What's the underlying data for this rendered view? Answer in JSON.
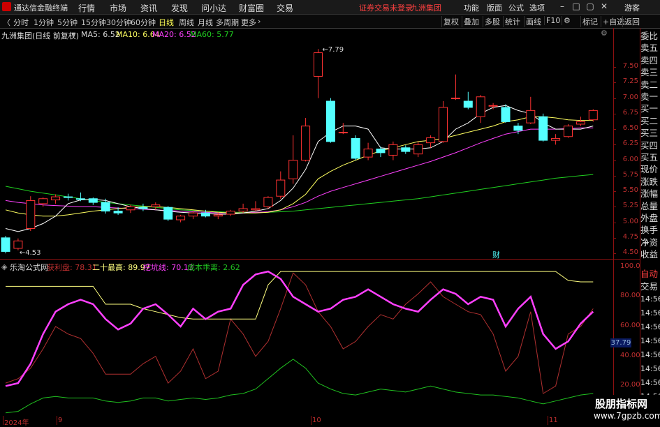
{
  "app": {
    "title": "通达信金融终端",
    "menus": [
      "行情",
      "市场",
      "资讯",
      "发现",
      "问小达",
      "财富圈",
      "交易"
    ],
    "notice": "证券交易未登录",
    "broker": "九洲集团",
    "right_menus": [
      "功能",
      "版面",
      "公式",
      "选项"
    ],
    "guest": "游客"
  },
  "toolbar": {
    "periods": [
      "分时",
      "1分钟",
      "5分钟",
      "15分钟",
      "30分钟",
      "60分钟",
      "日线",
      "周线",
      "月线",
      "多周期",
      "更多"
    ],
    "active": "日线",
    "right_buttons": [
      "复权",
      "叠加",
      "多股",
      "统计",
      "画线",
      "F10",
      "标记",
      "+自选",
      "返回"
    ]
  },
  "main_info": {
    "stock": "九洲集团(日线 前复权)",
    "ma5": "MA5: 6.52",
    "ma10": "MA10: 6.64",
    "ma20": "MA20: 6.52",
    "ma60": "MA60: 5.77",
    "high_label": "7.79",
    "low_label": "4.53",
    "event_marker": "财"
  },
  "sub_info": {
    "formula": "乐淘公式网",
    "l1": "获利盘: 78.31",
    "l2": "二十最高: 89.97",
    "l3": "挖坑线: 70.13",
    "l4": "成本乖离: 2.62"
  },
  "right_panel": {
    "items": [
      "委比",
      "卖五",
      "卖四",
      "卖三",
      "卖二",
      "卖一",
      "买一",
      "买二",
      "买三",
      "买四",
      "买五",
      "现价",
      "涨跌",
      "涨幅",
      "总量",
      "外盘",
      "换手",
      "净资",
      "收益"
    ],
    "lower_items": [
      "自动",
      "交易"
    ],
    "times": [
      "14:56",
      "14:56",
      "14:56",
      "14:56",
      "14:56",
      "14:56",
      "14:56",
      "14:56"
    ]
  },
  "axes": {
    "main_ticks": [
      "7.50",
      "7.25",
      "7.00",
      "6.75",
      "6.50",
      "6.25",
      "6.00",
      "5.75",
      "5.50",
      "5.25",
      "5.00",
      "4.75",
      "4.50"
    ],
    "sub_ticks": [
      "100.0",
      "80.00",
      "60.00",
      "40.00",
      "20.00"
    ],
    "sub_current": "37.79",
    "x_labels": [
      "2024年",
      "9",
      "10",
      "11"
    ]
  },
  "colors": {
    "up": "#ff3232",
    "down": "#54ffff",
    "ma5": "#ffffff",
    "ma10": "#ffff60",
    "ma20": "#ff40ff",
    "ma60": "#20d020",
    "profit": "#b03030",
    "high20": "#ffff80",
    "dig": "#ff40ff",
    "cost": "#20c020"
  },
  "chart_data": {
    "type": "candlestick",
    "price_axis": [
      4.4,
      7.95
    ],
    "candles": [
      {
        "o": 4.75,
        "h": 4.78,
        "l": 4.5,
        "c": 4.53
      },
      {
        "o": 4.58,
        "h": 4.74,
        "l": 4.55,
        "c": 4.7
      },
      {
        "o": 4.9,
        "h": 5.42,
        "l": 4.86,
        "c": 5.35
      },
      {
        "o": 5.3,
        "h": 5.4,
        "l": 5.25,
        "c": 5.38
      },
      {
        "o": 5.36,
        "h": 5.45,
        "l": 5.3,
        "c": 5.41
      },
      {
        "o": 5.41,
        "h": 5.46,
        "l": 5.35,
        "c": 5.4
      },
      {
        "o": 5.38,
        "h": 5.48,
        "l": 5.34,
        "c": 5.37
      },
      {
        "o": 5.38,
        "h": 5.4,
        "l": 5.28,
        "c": 5.32
      },
      {
        "o": 5.32,
        "h": 5.38,
        "l": 5.14,
        "c": 5.18
      },
      {
        "o": 5.18,
        "h": 5.24,
        "l": 5.12,
        "c": 5.15
      },
      {
        "o": 5.2,
        "h": 5.28,
        "l": 5.15,
        "c": 5.25
      },
      {
        "o": 5.24,
        "h": 5.3,
        "l": 5.18,
        "c": 5.22
      },
      {
        "o": 5.25,
        "h": 5.32,
        "l": 5.2,
        "c": 5.28
      },
      {
        "o": 5.24,
        "h": 5.26,
        "l": 5.02,
        "c": 5.05
      },
      {
        "o": 5.04,
        "h": 5.12,
        "l": 5.0,
        "c": 5.1
      },
      {
        "o": 5.1,
        "h": 5.18,
        "l": 5.05,
        "c": 5.15
      },
      {
        "o": 5.15,
        "h": 5.2,
        "l": 5.08,
        "c": 5.1
      },
      {
        "o": 5.1,
        "h": 5.16,
        "l": 5.05,
        "c": 5.12
      },
      {
        "o": 5.13,
        "h": 5.2,
        "l": 5.1,
        "c": 5.18
      },
      {
        "o": 5.18,
        "h": 5.3,
        "l": 5.15,
        "c": 5.22
      },
      {
        "o": 5.2,
        "h": 5.34,
        "l": 5.18,
        "c": 5.22
      },
      {
        "o": 5.25,
        "h": 5.42,
        "l": 5.22,
        "c": 5.4
      },
      {
        "o": 5.42,
        "h": 5.82,
        "l": 5.38,
        "c": 5.68
      },
      {
        "o": 5.7,
        "h": 6.4,
        "l": 5.62,
        "c": 6.0
      },
      {
        "o": 6.0,
        "h": 6.68,
        "l": 5.98,
        "c": 6.55
      },
      {
        "o": 7.35,
        "h": 7.79,
        "l": 7.0,
        "c": 7.73
      },
      {
        "o": 6.95,
        "h": 7.0,
        "l": 6.28,
        "c": 6.3
      },
      {
        "o": 6.45,
        "h": 6.6,
        "l": 6.42,
        "c": 6.45
      },
      {
        "o": 6.35,
        "h": 6.4,
        "l": 6.0,
        "c": 6.03
      },
      {
        "o": 6.05,
        "h": 6.28,
        "l": 6.0,
        "c": 6.18
      },
      {
        "o": 6.18,
        "h": 6.22,
        "l": 6.05,
        "c": 6.12
      },
      {
        "o": 6.08,
        "h": 6.3,
        "l": 6.0,
        "c": 6.25
      },
      {
        "o": 6.2,
        "h": 6.24,
        "l": 6.1,
        "c": 6.14
      },
      {
        "o": 6.1,
        "h": 6.3,
        "l": 6.05,
        "c": 6.25
      },
      {
        "o": 6.28,
        "h": 6.4,
        "l": 6.2,
        "c": 6.36
      },
      {
        "o": 6.3,
        "h": 6.95,
        "l": 6.28,
        "c": 6.85
      },
      {
        "o": 7.0,
        "h": 7.38,
        "l": 6.97,
        "c": 7.0
      },
      {
        "o": 6.95,
        "h": 7.1,
        "l": 6.82,
        "c": 6.85
      },
      {
        "o": 6.7,
        "h": 7.05,
        "l": 6.6,
        "c": 7.02
      },
      {
        "o": 6.88,
        "h": 6.92,
        "l": 6.82,
        "c": 6.88
      },
      {
        "o": 6.85,
        "h": 6.9,
        "l": 6.6,
        "c": 6.62
      },
      {
        "o": 6.55,
        "h": 6.6,
        "l": 6.42,
        "c": 6.48
      },
      {
        "o": 6.6,
        "h": 7.02,
        "l": 6.58,
        "c": 6.8
      },
      {
        "o": 6.7,
        "h": 6.75,
        "l": 6.3,
        "c": 6.32
      },
      {
        "o": 6.32,
        "h": 6.42,
        "l": 6.25,
        "c": 6.35
      },
      {
        "o": 6.38,
        "h": 6.58,
        "l": 6.36,
        "c": 6.55
      },
      {
        "o": 6.58,
        "h": 6.7,
        "l": 6.55,
        "c": 6.62
      },
      {
        "o": 6.65,
        "h": 6.82,
        "l": 6.62,
        "c": 6.8
      }
    ],
    "ma5": [
      4.9,
      4.85,
      4.9,
      4.98,
      5.1,
      5.3,
      5.36,
      5.37,
      5.35,
      5.3,
      5.25,
      5.22,
      5.2,
      5.18,
      5.16,
      5.15,
      5.14,
      5.13,
      5.13,
      5.15,
      5.18,
      5.22,
      5.35,
      5.55,
      5.85,
      6.3,
      6.45,
      6.55,
      6.55,
      6.5,
      6.2,
      6.18,
      6.18,
      6.18,
      6.2,
      6.3,
      6.5,
      6.6,
      6.75,
      6.85,
      6.88,
      6.8,
      6.75,
      6.6,
      6.5,
      6.5,
      6.5,
      6.55
    ],
    "ma10": [
      5.2,
      5.15,
      5.12,
      5.1,
      5.1,
      5.12,
      5.15,
      5.18,
      5.2,
      5.22,
      5.24,
      5.25,
      5.25,
      5.24,
      5.22,
      5.2,
      5.18,
      5.16,
      5.15,
      5.15,
      5.15,
      5.16,
      5.2,
      5.3,
      5.45,
      5.7,
      5.82,
      5.92,
      6.0,
      6.08,
      6.15,
      6.2,
      6.25,
      6.3,
      6.32,
      6.35,
      6.4,
      6.45,
      6.5,
      6.55,
      6.62,
      6.65,
      6.7,
      6.7,
      6.68,
      6.65,
      6.64,
      6.64
    ],
    "ma20": [
      5.35,
      5.32,
      5.3,
      5.28,
      5.27,
      5.26,
      5.25,
      5.25,
      5.24,
      5.23,
      5.22,
      5.21,
      5.2,
      5.19,
      5.18,
      5.17,
      5.16,
      5.15,
      5.15,
      5.15,
      5.16,
      5.17,
      5.2,
      5.25,
      5.32,
      5.42,
      5.5,
      5.56,
      5.62,
      5.68,
      5.74,
      5.8,
      5.86,
      5.92,
      5.98,
      6.05,
      6.12,
      6.2,
      6.28,
      6.35,
      6.42,
      6.46,
      6.5,
      6.5,
      6.5,
      6.51,
      6.52,
      6.52
    ],
    "ma60": [
      5.58,
      5.54,
      5.5,
      5.47,
      5.44,
      5.41,
      5.38,
      5.35,
      5.32,
      5.3,
      5.28,
      5.26,
      5.24,
      5.22,
      5.2,
      5.19,
      5.18,
      5.17,
      5.16,
      5.16,
      5.16,
      5.16,
      5.17,
      5.18,
      5.2,
      5.22,
      5.24,
      5.26,
      5.28,
      5.3,
      5.32,
      5.34,
      5.36,
      5.38,
      5.41,
      5.44,
      5.47,
      5.5,
      5.53,
      5.56,
      5.59,
      5.62,
      5.65,
      5.68,
      5.71,
      5.73,
      5.75,
      5.77
    ],
    "sub_axis": [
      0,
      105
    ],
    "profit": [
      22,
      25,
      32,
      45,
      60,
      55,
      52,
      42,
      28,
      28,
      28,
      35,
      40,
      22,
      30,
      45,
      25,
      30,
      65,
      55,
      40,
      50,
      72,
      96,
      88,
      70,
      60,
      45,
      50,
      60,
      68,
      65,
      75,
      82,
      90,
      80,
      75,
      70,
      68,
      55,
      30,
      40,
      70,
      15,
      20,
      55,
      60,
      72
    ],
    "high20": [
      87,
      87,
      87,
      87,
      87,
      87,
      87,
      87,
      75,
      75,
      75,
      72,
      70,
      68,
      66,
      65,
      65,
      65,
      65,
      65,
      65,
      88,
      97,
      97,
      97,
      97,
      97,
      97,
      97,
      97,
      97,
      97,
      97,
      97,
      97,
      97,
      97,
      97,
      97,
      97,
      97,
      97,
      97,
      97,
      97,
      91,
      90,
      90
    ],
    "dig": [
      20,
      22,
      35,
      55,
      70,
      75,
      78,
      75,
      65,
      58,
      62,
      72,
      75,
      68,
      60,
      72,
      65,
      70,
      72,
      88,
      95,
      97,
      92,
      80,
      75,
      70,
      72,
      78,
      80,
      85,
      80,
      75,
      72,
      70,
      78,
      85,
      82,
      75,
      80,
      78,
      60,
      72,
      80,
      55,
      45,
      50,
      62,
      70
    ],
    "cost": [
      2,
      3,
      8,
      12,
      13,
      12,
      12,
      12,
      10,
      9,
      10,
      12,
      12,
      10,
      11,
      12,
      11,
      12,
      14,
      15,
      18,
      25,
      32,
      38,
      32,
      22,
      18,
      15,
      14,
      16,
      18,
      17,
      16,
      18,
      20,
      18,
      16,
      15,
      14,
      14,
      13,
      12,
      10,
      8,
      10,
      12,
      14,
      15
    ]
  }
}
